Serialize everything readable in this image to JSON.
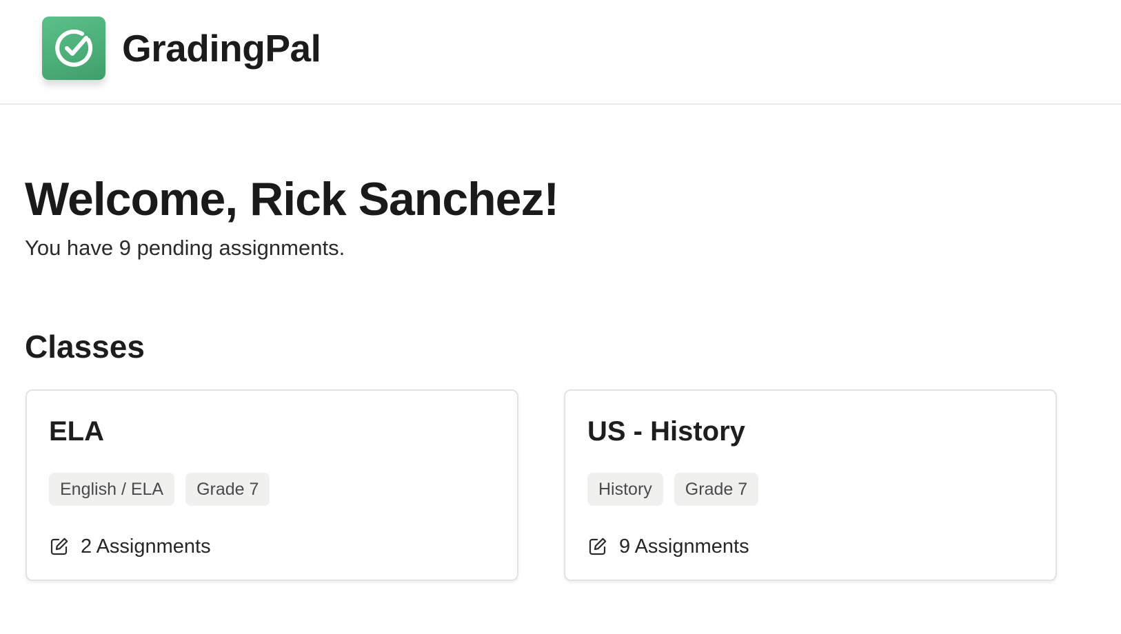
{
  "app": {
    "name": "GradingPal",
    "accent_color": "#4cae77",
    "logo_icon": "check-circle-icon"
  },
  "welcome": {
    "title": "Welcome, Rick Sanchez!",
    "subtitle": "You have 9 pending assignments."
  },
  "classes": {
    "section_title": "Classes",
    "items": [
      {
        "title": "ELA",
        "tags": [
          "English / ELA",
          "Grade 7"
        ],
        "assignments_label": "2 Assignments",
        "icon": "edit-square-icon"
      },
      {
        "title": "US - History",
        "tags": [
          "History",
          "Grade 7"
        ],
        "assignments_label": "9 Assignments",
        "icon": "edit-square-icon"
      }
    ]
  }
}
